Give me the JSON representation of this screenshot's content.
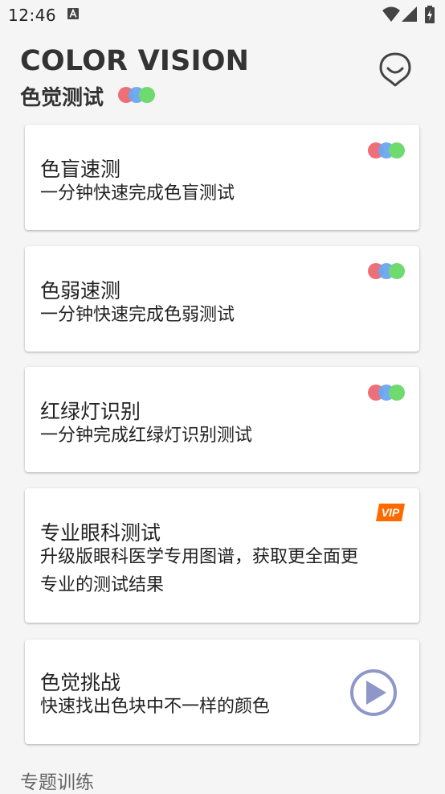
{
  "status_bar": {
    "time": "12:46"
  },
  "header": {
    "title": "COLOR VISION",
    "subtitle": "色觉测试"
  },
  "cards": [
    {
      "title": "色盲速测",
      "desc": "一分钟快速完成色盲测试",
      "badge": "color-dots"
    },
    {
      "title": "色弱速测",
      "desc": "一分钟快速完成色弱测试",
      "badge": "color-dots"
    },
    {
      "title": "红绿灯识别",
      "desc": "一分钟完成红绿灯识别测试",
      "badge": "color-dots"
    },
    {
      "title": "专业眼科测试",
      "desc_line1": "升级版眼科医学专用图谱，获取更全面更",
      "desc_line2": "专业的测试结果",
      "badge": "VIP"
    },
    {
      "title": "色觉挑战",
      "desc": "快速找出色块中不一样的颜色",
      "badge": "play-icon"
    }
  ],
  "section_heading": "专题训练",
  "colors": {
    "dot_red": "#ef6f78",
    "dot_blue": "#6aa6ef",
    "dot_green": "#6fdb6f",
    "vip_orange": "#ff6a00",
    "play_purple": "#8f97c8"
  }
}
